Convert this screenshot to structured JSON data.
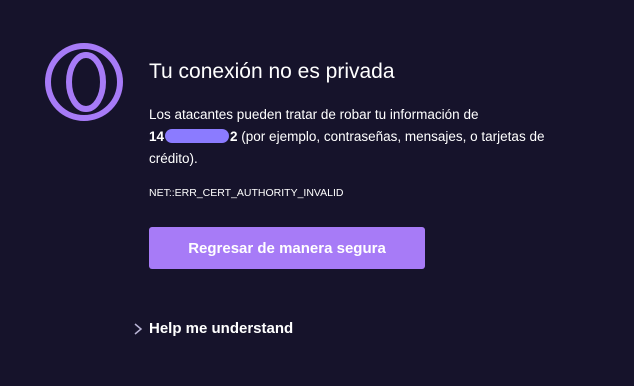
{
  "colors": {
    "background": "#16132b",
    "accent": "#a77bf7",
    "logo": "#a77bf7",
    "redaction": "#8b7bff"
  },
  "logo": {
    "icon": "opera-gx-logo-icon"
  },
  "error": {
    "title": "Tu conexión no es privada",
    "desc_prefix": "Los atacantes pueden tratar de robar tu información de",
    "host_start": "14",
    "host_end": "2",
    "desc_suffix": " (por ejemplo, contraseñas, mensajes, o tarjetas de crédito).",
    "code": "NET::ERR_CERT_AUTHORITY_INVALID"
  },
  "actions": {
    "back_label": "Regresar de manera segura",
    "help_label": "Help me understand",
    "help_icon": "chevron-right-icon"
  }
}
